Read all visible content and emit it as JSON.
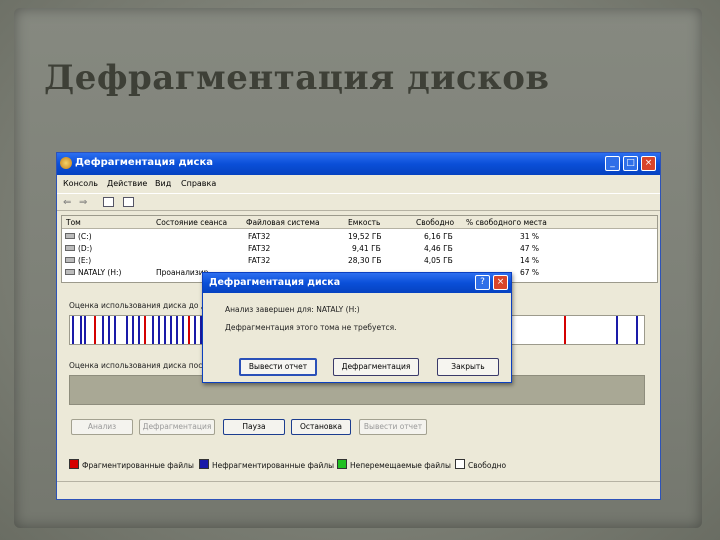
{
  "slide": {
    "title": "Дефрагментация дисков"
  },
  "window": {
    "title": "Дефрагментация диска",
    "minimize": "_",
    "maximize": "□",
    "close": "×"
  },
  "menu": [
    "Консоль",
    "Действие",
    "Вид",
    "Справка"
  ],
  "toolbar": {
    "back": "⇐",
    "forward": "⇒"
  },
  "volumes": {
    "columns": [
      "Том",
      "Состояние сеанса",
      "Файловая система",
      "Емкость",
      "Свободно",
      "% свободного места"
    ],
    "rows": [
      {
        "name": "(C:)",
        "status": "",
        "fs": "FAT32",
        "capacity": "19,52 ГБ",
        "free": "6,16 ГБ",
        "pct": "31 %"
      },
      {
        "name": "(D:)",
        "status": "",
        "fs": "FAT32",
        "capacity": "9,41 ГБ",
        "free": "4,46 ГБ",
        "pct": "47 %"
      },
      {
        "name": "(E:)",
        "status": "",
        "fs": "FAT32",
        "capacity": "28,30 ГБ",
        "free": "4,05 ГБ",
        "pct": "14 %"
      },
      {
        "name": "NATALY (H:)",
        "status": "Проанализир...",
        "fs": "",
        "capacity": "",
        "free": "",
        "pct": "67 %"
      }
    ]
  },
  "usage_before_label": "Оценка использования диска до д...",
  "usage_after_label": "Оценка использования диска посл...",
  "buttons": {
    "analyze": "Анализ",
    "defrag": "Дефрагментация",
    "pause": "Пауза",
    "stop": "Остановка",
    "report": "Вывести отчет"
  },
  "legend": [
    {
      "label": "Фрагментированные файлы",
      "color": "#d40000"
    },
    {
      "label": "Нефрагментированные файлы",
      "color": "#1a1aa8"
    },
    {
      "label": "Неперемещаемые файлы",
      "color": "#22c022"
    },
    {
      "label": "Свободно",
      "color": "#ffffff"
    }
  ],
  "dialog": {
    "title": "Дефрагментация диска",
    "help": "?",
    "close": "×",
    "line1": "Анализ завершен для: NATALY (H:)",
    "line2": "Дефрагментация этого тома не требуется.",
    "btn_report": "Вывести отчет",
    "btn_defrag": "Дефрагментация",
    "btn_close": "Закрыть"
  }
}
